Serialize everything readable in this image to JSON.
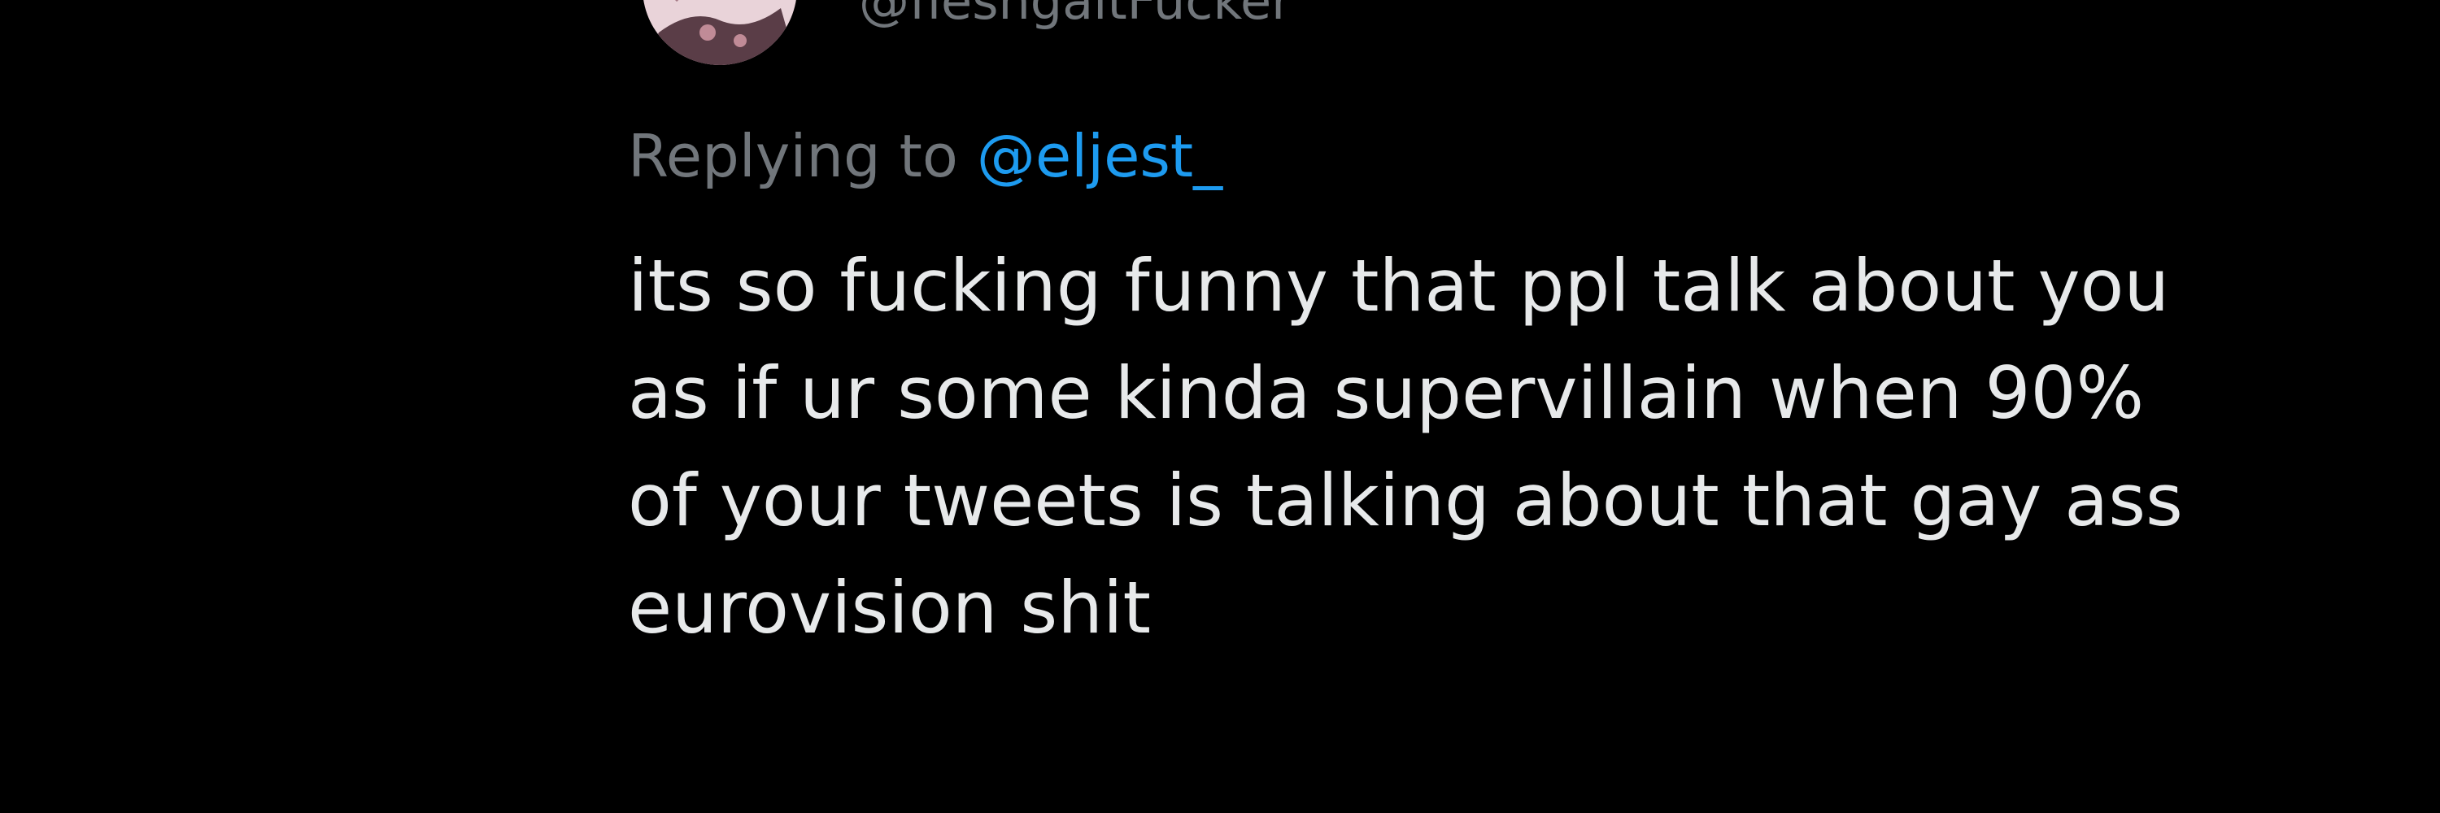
{
  "tweet": {
    "author_handle": "@fleshgaitFucker",
    "replying_to_prefix": "Replying to",
    "replying_to_handle": "@eljest_",
    "text_lines": [
      "its so fucking funny that ppl talk about you",
      "as if ur some kinda supervillain when 90%",
      "of your tweets is talking about that gay ass",
      "eurovision shit"
    ]
  },
  "colors": {
    "background": "#000000",
    "text": "#e7e9ea",
    "secondary": "#71767b",
    "accent": "#1d9bf0"
  },
  "icons": {
    "avatar": "user-avatar"
  }
}
